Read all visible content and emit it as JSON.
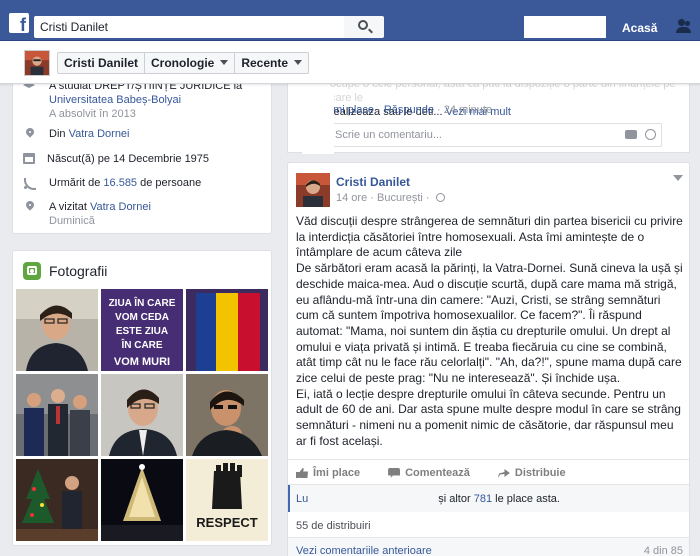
{
  "topbar": {
    "search_value": "Cristi Danilet",
    "home_label": "Acasă",
    "icons": [
      "facebook-logo",
      "search-icon",
      "friends-icon"
    ]
  },
  "sticky": {
    "name": "Cristi Danilet",
    "timeline": "Cronologie",
    "recent": "Recente"
  },
  "intro": {
    "studied_line1": "A studiat DREPT/ȘTIINȚE JURIDICE la",
    "studied_line2": "Universitatea Babeș-Bolyai",
    "studied_sub": "A absolvit în 2013",
    "from_prefix": "Din ",
    "from_place": "Vatra Dornei",
    "born_prefix": "Născut(ă) pe ",
    "born_date": "14 Decembrie 1975",
    "followed_prefix": "Urmărit de ",
    "followed_count": "16.585",
    "followed_suffix": " de persoane",
    "visited_prefix": "A vizitat ",
    "visited_place": "Vatra Dornei",
    "visited_sub": "Duminică"
  },
  "photos": {
    "title": "Fotografii",
    "banner_lines": [
      "ZIUA ÎN CARE",
      "VOM CEDA",
      "ESTE ZIUA",
      "ÎN CARE",
      "VOM MURI"
    ],
    "respect": "RESPECT"
  },
  "prev_comment": {
    "line1": "ocupe o cele personal, asta ca puti la dispoziție o parte din finanțele pe care le",
    "line2_text": "realizeaza sau le deti... ",
    "more": "Vezi mai mult",
    "like": "Îmi place",
    "reply": "Răspunde",
    "time": "24 minute",
    "input_placeholder": "Scrie un comentariu..."
  },
  "post": {
    "author": "Cristi Danilet",
    "time": "14 ore",
    "location": "București",
    "paragraphs": [
      "Văd discuții despre strângerea de semnături din partea bisericii cu privire la interdicția căsătoriei între homosexuali. Asta îmi amintește de o întâmplare de acum câteva zile",
      "De sărbători eram acasă la părinți, la Vatra-Dornei. Sună cineva la ușă și deschide maica-mea. Aud o discuție scurtă, după care mama mă strigă, eu aflându-mă într-una din camere: \"Auzi, Cristi, se strâng semnături cum că suntem împotriva homosexualilor. Ce facem?\". Îi răspund automat: \"Mama, noi suntem din ăștia cu drepturile omului. Un drept al omului e viața privată și intimă. E treaba fiecăruia cu cine se combină, atât timp cât nu le face rău celorlalți\". \"Ah, da?!\", spune mama după care zice celui de peste prag: \"Nu ne interesează\". Și închide ușa.",
      "Ei, iată o lecție despre drepturile omului în câteva secunde. Pentru un adult de 60 de ani. Dar asta spune multe despre modul în care se strâng semnături - nimeni nu a pomenit nimic de căsătorie, dar răspunsul meu ar fi fost același."
    ],
    "like_label": "Îmi place",
    "comment_label": "Comentează",
    "share_label": "Distribuie",
    "likes_prefix": "Lu",
    "likes_mid": "și altor ",
    "likes_count": "781",
    "likes_suffix": " le place asta.",
    "shares": "55 de distribuiri",
    "prev_comments": "Vezi comentariile anterioare",
    "comment_count": "4 din 85"
  }
}
